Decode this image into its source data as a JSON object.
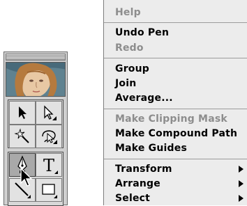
{
  "menu": {
    "items": [
      {
        "label": "Help",
        "enabled": false,
        "submenu": false
      },
      {
        "label": "Undo Pen",
        "enabled": true,
        "submenu": false
      },
      {
        "label": "Redo",
        "enabled": false,
        "submenu": false
      },
      {
        "label": "Group",
        "enabled": true,
        "submenu": false
      },
      {
        "label": "Join",
        "enabled": true,
        "submenu": false
      },
      {
        "label": "Average...",
        "enabled": true,
        "submenu": false
      },
      {
        "label": "Make Clipping Mask",
        "enabled": false,
        "submenu": false
      },
      {
        "label": "Make Compound Path",
        "enabled": true,
        "submenu": false
      },
      {
        "label": "Make Guides",
        "enabled": true,
        "submenu": false
      },
      {
        "label": "Transform",
        "enabled": true,
        "submenu": true
      },
      {
        "label": "Arrange",
        "enabled": true,
        "submenu": true
      },
      {
        "label": "Select",
        "enabled": true,
        "submenu": true
      }
    ]
  },
  "toolbox": {
    "tools": [
      {
        "name": "selection-tool-icon"
      },
      {
        "name": "direct-selection-tool-icon"
      },
      {
        "name": "magic-wand-tool-icon"
      },
      {
        "name": "lasso-tool-icon"
      },
      {
        "name": "pen-tool-icon",
        "selected": true
      },
      {
        "name": "type-tool-icon",
        "glyph": "T"
      },
      {
        "name": "line-tool-icon"
      },
      {
        "name": "rectangle-tool-icon"
      }
    ]
  },
  "colors": {
    "menu_bg": "#ececec",
    "disabled_text": "#8d8d8d",
    "toolbox_bg": "#cfcfcf"
  }
}
